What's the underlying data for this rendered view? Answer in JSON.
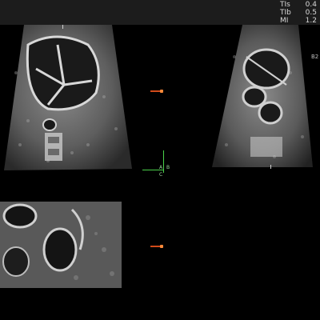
{
  "readouts": [
    {
      "label": "TIs",
      "value": "0.4"
    },
    {
      "label": "TIb",
      "value": "0.5"
    },
    {
      "label": "MI",
      "value": "1.2"
    }
  ],
  "panel_tag": "B2",
  "axes": {
    "a": "A",
    "b": "B",
    "c": "C"
  },
  "colors": {
    "background": "#000000",
    "top_bar": "#1c1c1c",
    "crosshair": "#4ad14a",
    "marker": "#d14a1a",
    "text": "#d9d9d9"
  },
  "icons": [
    "crosshair-icon",
    "orientation-marker-icon"
  ]
}
